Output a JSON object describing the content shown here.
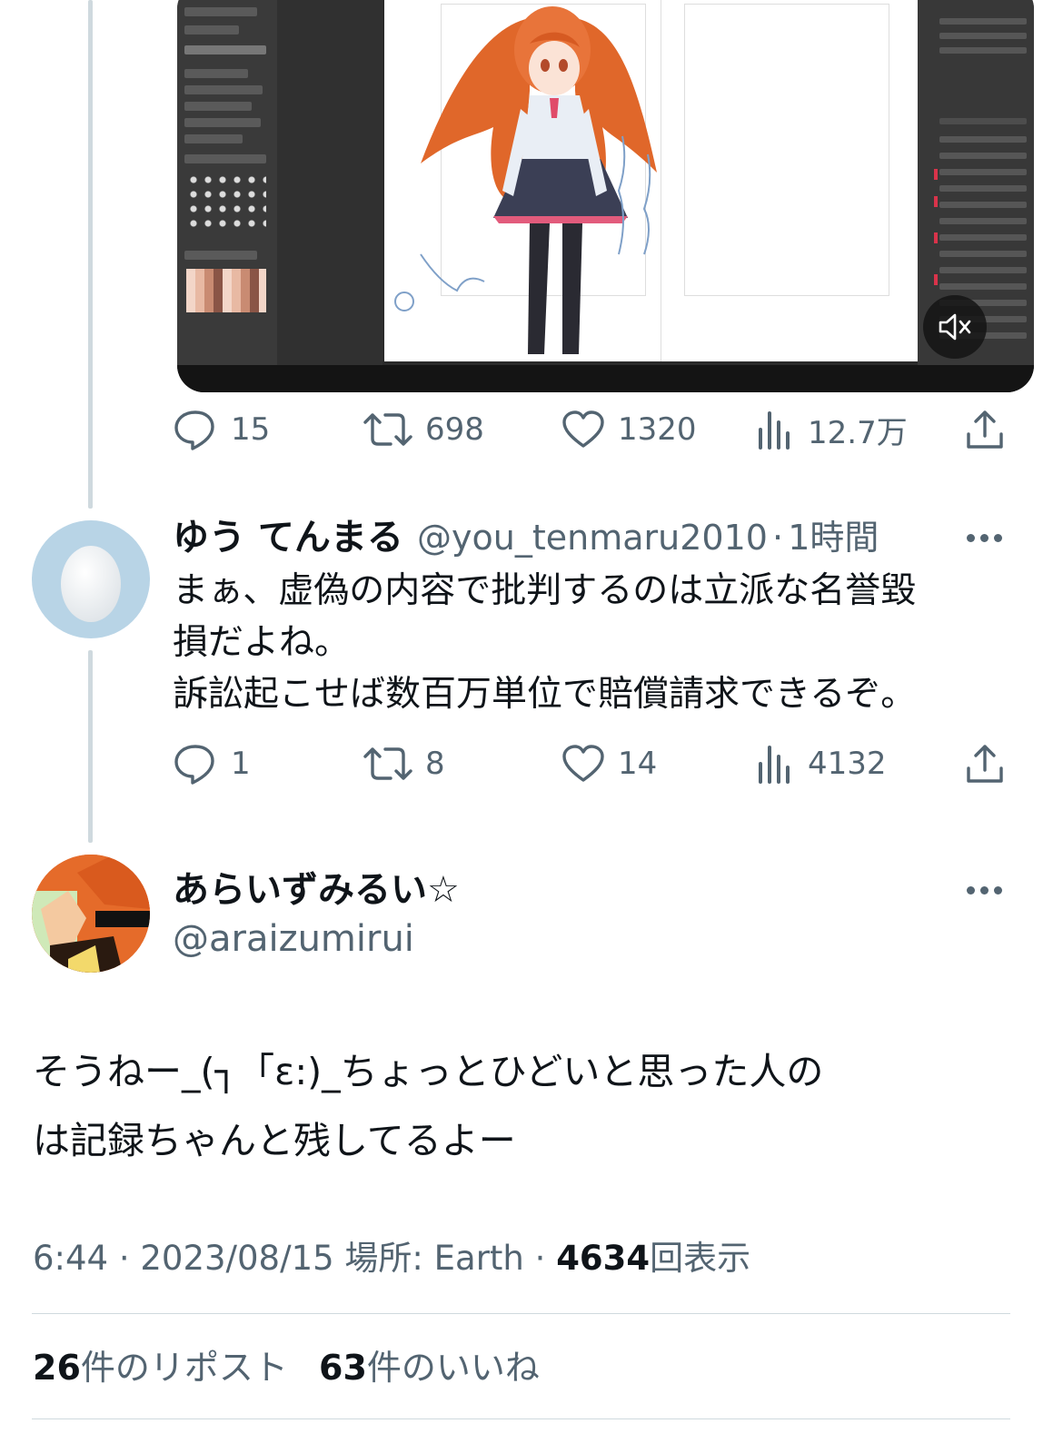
{
  "colors": {
    "text": "#0f1419",
    "secondary": "#536471",
    "divider": "#cfd9de",
    "egg_bg": "#b8d4e6"
  },
  "first_tweet": {
    "media": {
      "mute_icon": "volume-mute-icon"
    },
    "actions": {
      "replies": "15",
      "reposts": "698",
      "likes": "1320",
      "views": "12.7万"
    }
  },
  "reply_tweet": {
    "name": "ゆう てんまる",
    "handle": "@you_tenmaru2010",
    "separator": "·",
    "time": "1時間",
    "text": "まぁ、虚偽の内容で批判するのは立派な名誉毀\n損だよね。\n訴訟起こせば数百万単位で賠償請求できるぞ。",
    "actions": {
      "replies": "1",
      "reposts": "8",
      "likes": "14",
      "views": "4132"
    }
  },
  "main_tweet": {
    "name": "あらいずみるい☆",
    "handle": "@araizumirui",
    "text": "そうねー_(┐「ε:)_ちょっとひどいと思った人の\nは記録ちゃんと残してるよー",
    "meta": {
      "time": "6:44",
      "dot": "·",
      "date": "2023/08/15",
      "location_label": "場所:",
      "location": "Earth",
      "views_count": "4634",
      "views_label": "回表示"
    },
    "stats": {
      "reposts_count": "26",
      "reposts_label": "件のリポスト",
      "likes_count": "63",
      "likes_label": "件のいいね"
    }
  }
}
